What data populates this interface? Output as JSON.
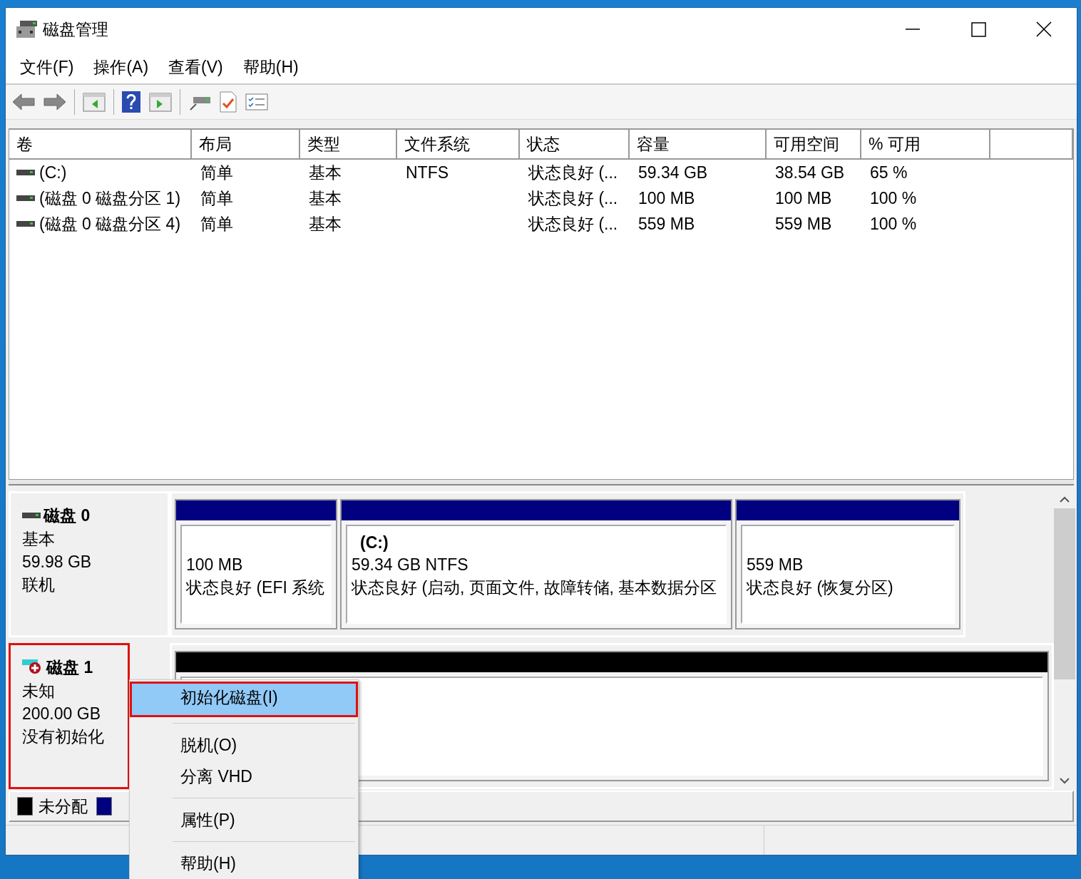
{
  "window": {
    "title": "磁盘管理"
  },
  "menu_bar": [
    "文件(F)",
    "操作(A)",
    "查看(V)",
    "帮助(H)"
  ],
  "table": {
    "columns": [
      "卷",
      "布局",
      "类型",
      "文件系统",
      "状态",
      "容量",
      "可用空间",
      "% 可用"
    ],
    "rows": [
      {
        "cells": [
          "(C:)",
          "简单",
          "基本",
          "NTFS",
          "状态良好 (...",
          "59.34 GB",
          "38.54 GB",
          "65 %"
        ]
      },
      {
        "cells": [
          "(磁盘 0 磁盘分区 1)",
          "简单",
          "基本",
          "",
          "状态良好 (...",
          "100 MB",
          "100 MB",
          "100 %"
        ]
      },
      {
        "cells": [
          "(磁盘 0 磁盘分区 4)",
          "简单",
          "基本",
          "",
          "状态良好 (...",
          "559 MB",
          "559 MB",
          "100 %"
        ]
      }
    ]
  },
  "disks": [
    {
      "name": "磁盘 0",
      "type": "基本",
      "size": "59.98 GB",
      "status": "联机",
      "kind": "online",
      "annotated": false,
      "partitions": [
        {
          "color": "#000080",
          "size": "100 MB",
          "status": "状态良好 (EFI 系统"
        },
        {
          "color": "#000080",
          "label": "(C:)",
          "size": "59.34 GB NTFS",
          "status": "状态良好 (启动, 页面文件, 故障转储, 基本数据分区"
        },
        {
          "color": "#000080",
          "size": "559 MB",
          "status": "状态良好 (恢复分区)"
        }
      ]
    },
    {
      "name": "磁盘 1",
      "type": "未知",
      "size": "200.00 GB",
      "status": "没有初始化",
      "kind": "uninitialized",
      "annotated": true,
      "partitions": [
        {
          "color": "#000000"
        }
      ]
    }
  ],
  "legend": [
    {
      "label": "未分配",
      "color": "#000000"
    },
    {
      "color": "#000080"
    }
  ],
  "context_menu": [
    {
      "kind": "item",
      "label": "初始化磁盘(I)",
      "selected": true,
      "annotated": true
    },
    {
      "kind": "separator"
    },
    {
      "kind": "item",
      "label": "脱机(O)",
      "selected": false,
      "annotated": false
    },
    {
      "kind": "item",
      "label": "分离 VHD",
      "selected": false,
      "annotated": false
    },
    {
      "kind": "separator"
    },
    {
      "kind": "item",
      "label": "属性(P)",
      "selected": false,
      "annotated": false
    },
    {
      "kind": "separator"
    },
    {
      "kind": "item",
      "label": "帮助(H)",
      "selected": false,
      "annotated": false
    }
  ]
}
